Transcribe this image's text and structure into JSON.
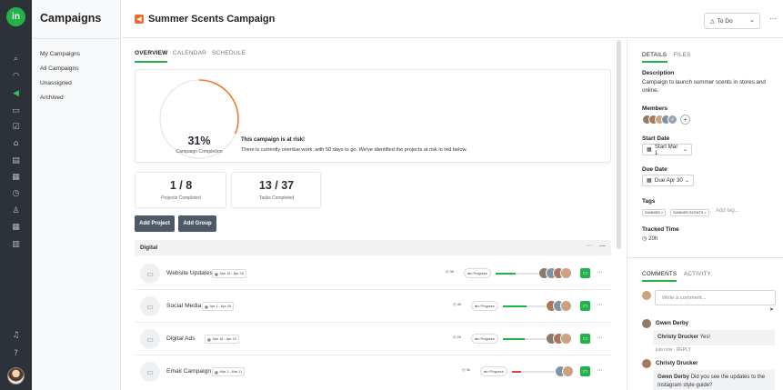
{
  "nav": {
    "title": "Campaigns",
    "items": [
      {
        "label": "My Campaigns"
      },
      {
        "label": "All Campaigns"
      },
      {
        "label": "Unassigned"
      },
      {
        "label": "Archived"
      }
    ]
  },
  "header": {
    "title": "Summer Scents Campaign",
    "status": "To Do"
  },
  "tabs": [
    "OVERVIEW",
    "CALENDAR",
    "SCHEDULE"
  ],
  "progress": {
    "percent_label": "31%",
    "percent": 31,
    "label": "Campaign Completion",
    "risk_title": "This campaign is at risk!",
    "risk_text": "There is currently overdue work, with 50 days to go. We've identified the projects at risk in red below."
  },
  "stats": [
    {
      "value": "1 / 8",
      "label": "Projects Completed"
    },
    {
      "value": "13 / 37",
      "label": "Tasks Completed"
    }
  ],
  "buttons": {
    "add_project": "Add Project",
    "add_group": "Add Group"
  },
  "group": {
    "name": "Digital",
    "more": "···",
    "collapse": "—"
  },
  "projects": [
    {
      "name": "Website Updates",
      "dates": "Mar 15 - Apr 26",
      "time": "3h",
      "status": "In Progress",
      "progress": 0.45,
      "bar_color": "#21b34a"
    },
    {
      "name": "Social Media",
      "dates": "Apr 1 - Apr 26",
      "time": "4h",
      "status": "In Progress",
      "progress": 0.55,
      "bar_color": "#21b34a"
    },
    {
      "name": "Digital Ads",
      "dates": "Mar 18 - Apr 19",
      "time": "2h",
      "status": "In Progress",
      "progress": 0.5,
      "bar_color": "#21b34a"
    },
    {
      "name": "Email Campaign",
      "dates": "Mar 1 - Mar 11",
      "time": "3h",
      "status": "In Progress",
      "progress": 0.2,
      "bar_color": "#e0413b"
    }
  ],
  "side": {
    "tabs": [
      "DETAILS",
      "FILES"
    ],
    "description_label": "Description",
    "description": "Campaign to launch summer scents in stores and online.",
    "members_label": "Members",
    "start_label": "Start Date",
    "start_value": "Start Mar 1",
    "due_label": "Due Date",
    "due_value": "Due Apr 30",
    "tags_label": "Tags",
    "tags": [
      "SUMMER ×",
      "SUMMER SCENTS ×"
    ],
    "add_tag": "Add tag...",
    "tracked_label": "Tracked Time",
    "tracked_value": "20h",
    "comment_tabs": [
      "COMMENTS",
      "ACTIVITY"
    ],
    "comment_placeholder": "Write a comment...",
    "comments": [
      {
        "author": "Gwen Derby",
        "mention": "Christy Drucker",
        "text": "Yes!",
        "time": "just now",
        "reply": "REPLY"
      },
      {
        "author": "Christy Drucker",
        "mention": "Gwen Derby",
        "text": "Did you see the updates to the Instagram style guide?"
      }
    ]
  }
}
